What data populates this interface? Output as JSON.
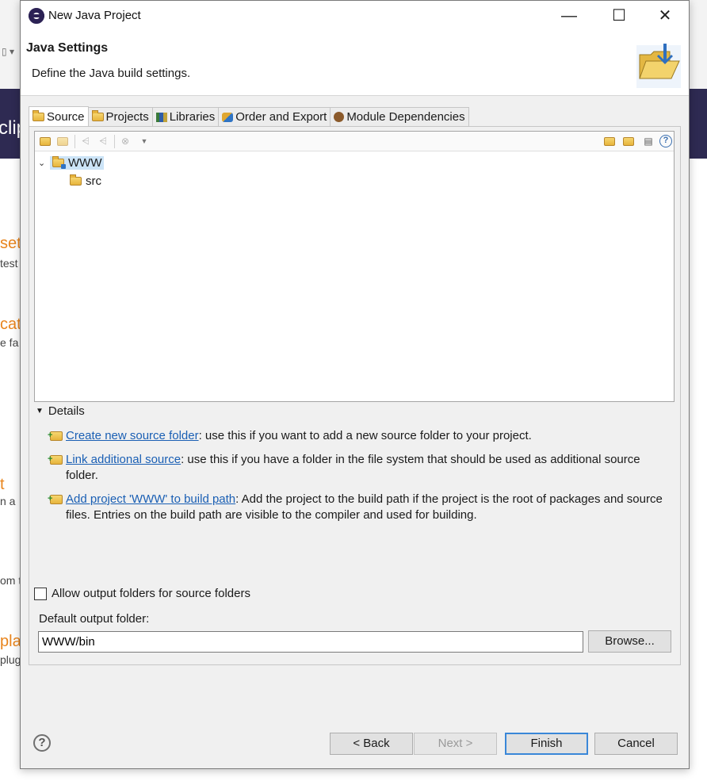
{
  "background": {
    "header_text": "clip",
    "fragments": [
      "sett",
      "test",
      "cat",
      "e fa",
      "t",
      "n a",
      "om t",
      "plac",
      "plug"
    ]
  },
  "dialog": {
    "title": "New Java Project",
    "window_controls": {
      "minimize": "—",
      "maximize": "☐",
      "close": "✕"
    },
    "banner": {
      "title": "Java Settings",
      "description": "Define the Java build settings."
    },
    "tabs": [
      {
        "label": "Source",
        "icon": "folder-icon",
        "active": true
      },
      {
        "label": "Projects",
        "icon": "projects-icon",
        "active": false
      },
      {
        "label": "Libraries",
        "icon": "libraries-icon",
        "active": false
      },
      {
        "label": "Order and Export",
        "icon": "order-export-icon",
        "active": false
      },
      {
        "label": "Module Dependencies",
        "icon": "module-icon",
        "active": false
      }
    ],
    "tree": {
      "root": {
        "label": "WWW",
        "expanded": true,
        "selected": true
      },
      "children": [
        {
          "label": "src"
        }
      ]
    },
    "details": {
      "header": "Details",
      "items": [
        {
          "link": "Create new source folder",
          "text": ": use this if you want to add a new source folder to your project."
        },
        {
          "link": "Link additional source",
          "text": ": use this if you have a folder in the file system that should be used as additional source folder."
        },
        {
          "link": "Add project 'WWW' to build path",
          "text": ": Add the project to the build path if the project is the root of packages and source files. Entries on the build path are visible to the compiler and used for building."
        }
      ]
    },
    "allow_output_folders": {
      "label": "Allow output folders for source folders",
      "checked": false
    },
    "output": {
      "label": "Default output folder:",
      "value": "WWW/bin",
      "browse_label": "Browse..."
    },
    "buttons": {
      "help": "?",
      "back": "< Back",
      "next": "Next >",
      "finish": "Finish",
      "cancel": "Cancel"
    },
    "colors": {
      "link": "#1a5fb4",
      "selection": "#cce4f7",
      "default_button_border": "#3a87d8"
    }
  }
}
